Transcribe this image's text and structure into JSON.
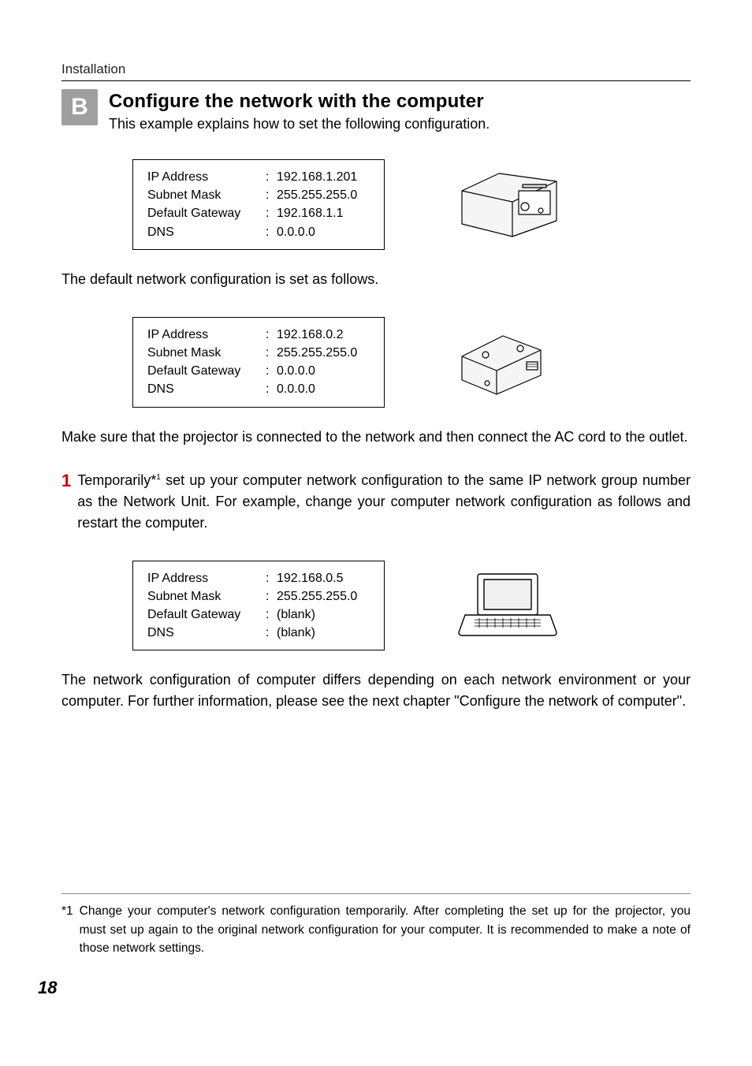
{
  "header": {
    "label": "Installation"
  },
  "section": {
    "badge": "B",
    "title": "Configure the network with the computer",
    "subtitle": "This example explains how to set the following configuration."
  },
  "config1": {
    "rows": [
      {
        "label": "IP Address",
        "value": "192.168.1.201"
      },
      {
        "label": "Subnet Mask",
        "value": "255.255.255.0"
      },
      {
        "label": "Default Gateway",
        "value": "192.168.1.1"
      },
      {
        "label": "DNS",
        "value": "0.0.0.0"
      }
    ]
  },
  "default_text": "The default network configuration is set as follows.",
  "config2": {
    "rows": [
      {
        "label": "IP Address",
        "value": "192.168.0.2"
      },
      {
        "label": "Subnet Mask",
        "value": "255.255.255.0"
      },
      {
        "label": "Default Gateway",
        "value": "0.0.0.0"
      },
      {
        "label": "DNS",
        "value": "0.0.0.0"
      }
    ]
  },
  "make_sure_text": "Make sure that the projector is connected to the network and then connect the AC cord to the outlet.",
  "step1": {
    "num": "1",
    "lead": "Temporarily*",
    "sup": "1",
    "bold_rest": " set up your computer network configuration to the same IP network group number as the Network Unit.",
    "rest": " For example, change your computer network configuration as follows and restart the computer."
  },
  "config3": {
    "rows": [
      {
        "label": "IP Address",
        "value": "192.168.0.5"
      },
      {
        "label": "Subnet Mask",
        "value": "255.255.255.0"
      },
      {
        "label": "Default Gateway",
        "value": "(blank)"
      },
      {
        "label": "DNS",
        "value": "(blank)"
      }
    ]
  },
  "closing_text": "The network configuration of computer differs depending on each network environment or your computer. For further information, please see the next chapter \"Configure the network of computer\".",
  "footnote": {
    "mark": "*1",
    "text": "Change your computer's network configuration temporarily. After completing the set up for the projector, you must set up again to the original network configuration for your computer. It is recommended to make a note of those network settings."
  },
  "page_number": "18"
}
